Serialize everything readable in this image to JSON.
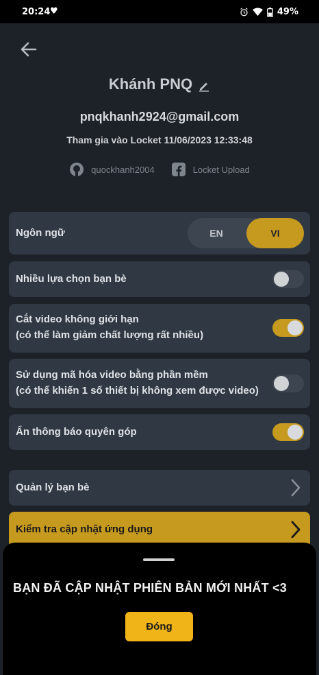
{
  "status_bar": {
    "time": "20:24",
    "battery_percent": "49%"
  },
  "profile": {
    "name": "Khánh PNQ",
    "email": "pnqkhanh2924@gmail.com",
    "joined": "Tham gia vào Locket 11/06/2023 12:33:48",
    "github": "quockhanh2004",
    "facebook": "Locket Upload"
  },
  "settings": {
    "language": {
      "label": "Ngôn ngữ",
      "options": [
        "EN",
        "VI"
      ],
      "selected": "VI"
    },
    "multi_select_friends": {
      "label": "Nhiều lựa chọn bạn bè",
      "enabled": false
    },
    "unlimited_video": {
      "label_line1": "Cắt video không giới hạn",
      "label_line2": "(có thể làm giảm chất lượng rất nhiều)",
      "enabled": true
    },
    "software_encoding": {
      "label_line1": "Sử dụng mã hóa video bằng phần mềm",
      "label_line2": "(có thể khiến 1 số thiết bị không xem được video)",
      "enabled": false
    },
    "hide_donate": {
      "label": "Ẩn thông báo quyên góp",
      "enabled": true
    }
  },
  "menu": {
    "manage_friends": "Quản lý bạn bè",
    "check_update": "Kiểm tra cập nhật ứng dụng"
  },
  "sheet": {
    "message": "BẠN ĐÃ CẬP NHẬT PHIÊN BẢN MỚI NHẤT <3",
    "button": "Đóng"
  },
  "colors": {
    "accent": "#c6991f",
    "button": "#f0b419",
    "card": "#2f3843",
    "background": "#1d2228"
  }
}
